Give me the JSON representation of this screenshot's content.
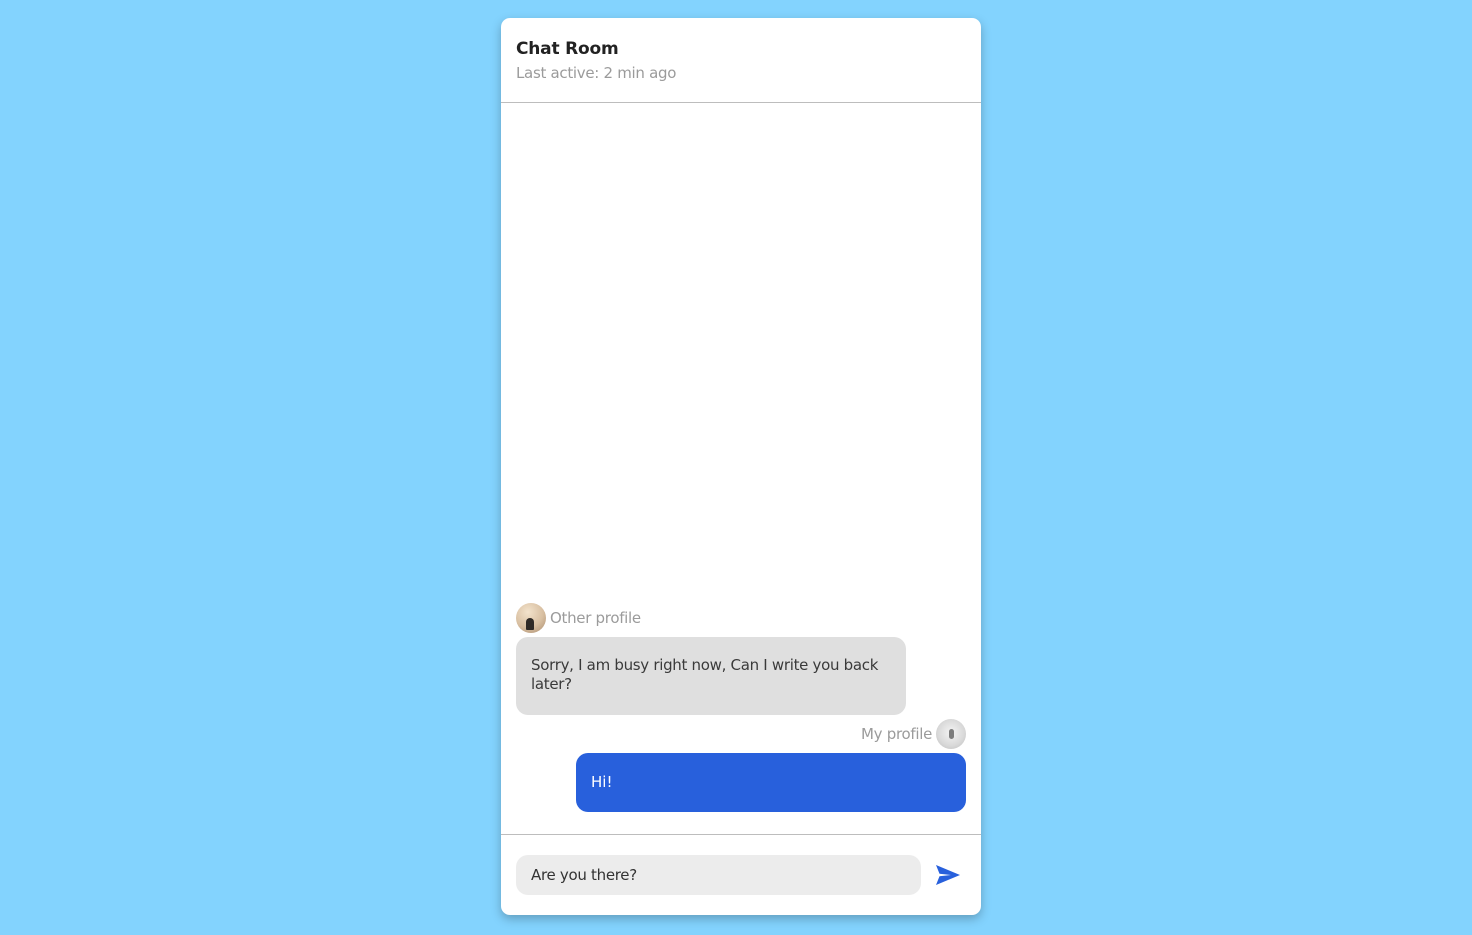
{
  "app": {
    "background_color": "#83d3fe",
    "accent_color": "#2860dc"
  },
  "header": {
    "title": "Chat Room",
    "status": "Last active: 2 min ago"
  },
  "messages": [
    {
      "sender": "Other profile",
      "avatar_icon": "avatar-other-icon",
      "text": "Sorry, I am busy right now, Can I write you back later?"
    },
    {
      "sender": "My profile",
      "avatar_icon": "avatar-mine-icon",
      "text": "Hi!"
    }
  ],
  "composer": {
    "input_value": "Are you there?",
    "send_icon": "send-icon"
  }
}
